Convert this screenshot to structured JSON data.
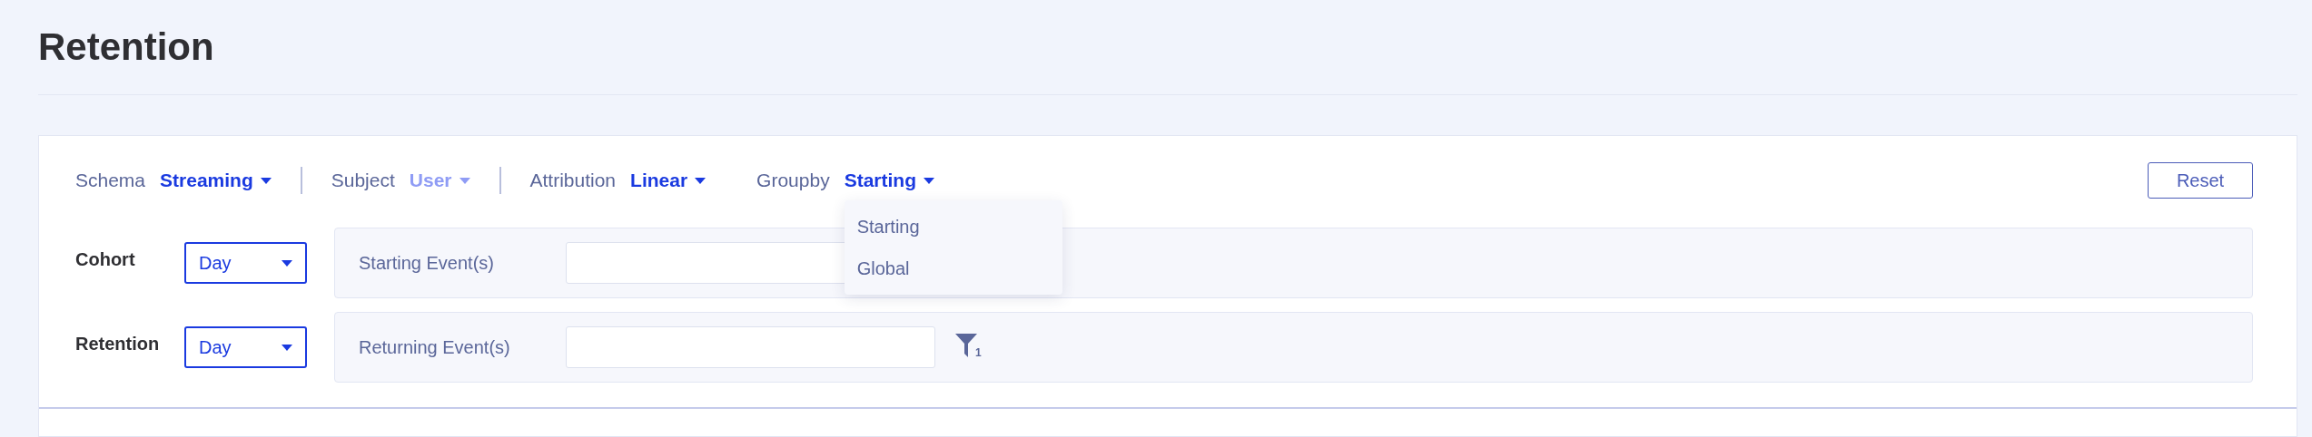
{
  "page": {
    "title": "Retention"
  },
  "filters": [
    {
      "label": "Schema",
      "value": "Streaming",
      "disabled": false,
      "divider_after": true
    },
    {
      "label": "Subject",
      "value": "User",
      "disabled": true,
      "divider_after": true
    },
    {
      "label": "Attribution",
      "value": "Linear",
      "disabled": false,
      "divider_after": false
    },
    {
      "label": "Groupby",
      "value": "Starting",
      "disabled": false,
      "divider_after": false,
      "menu": [
        "Starting",
        "Global"
      ]
    }
  ],
  "reset_button": "Reset",
  "rows": [
    {
      "label": "Cohort",
      "period": "Day",
      "event_label": "Starting Event(s)",
      "filter_count": null
    },
    {
      "label": "Retention",
      "period": "Day",
      "event_label": "Returning Event(s)",
      "filter_count": "1"
    }
  ]
}
